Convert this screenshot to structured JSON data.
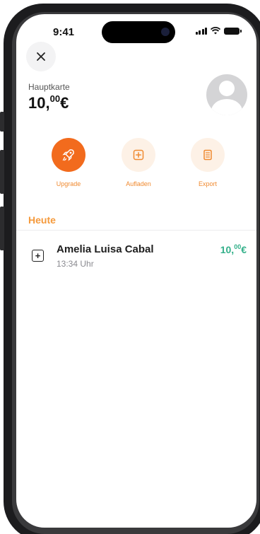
{
  "status_bar": {
    "time": "9:41"
  },
  "header": {
    "close_icon": "close-icon",
    "card_label": "Hauptkarte",
    "balance_main": "10,",
    "balance_cents": "00",
    "balance_currency": "€",
    "avatar_icon": "user-placeholder-icon"
  },
  "actions": [
    {
      "label": "Upgrade",
      "icon": "rocket-icon"
    },
    {
      "label": "Aufladen",
      "icon": "plus-square-icon"
    },
    {
      "label": "Export",
      "icon": "document-icon"
    }
  ],
  "section": {
    "title": "Heute"
  },
  "transactions": [
    {
      "name": "Amelia Luisa Cabal",
      "time": "13:34 Uhr",
      "amount_main": "10,",
      "amount_cents": "00",
      "amount_currency": "€",
      "icon": "plus-square-icon"
    }
  ],
  "colors": {
    "accent": "#f26b1d",
    "accent_label": "#f08a30",
    "section_title": "#f59a3c",
    "positive": "#33b08a"
  }
}
